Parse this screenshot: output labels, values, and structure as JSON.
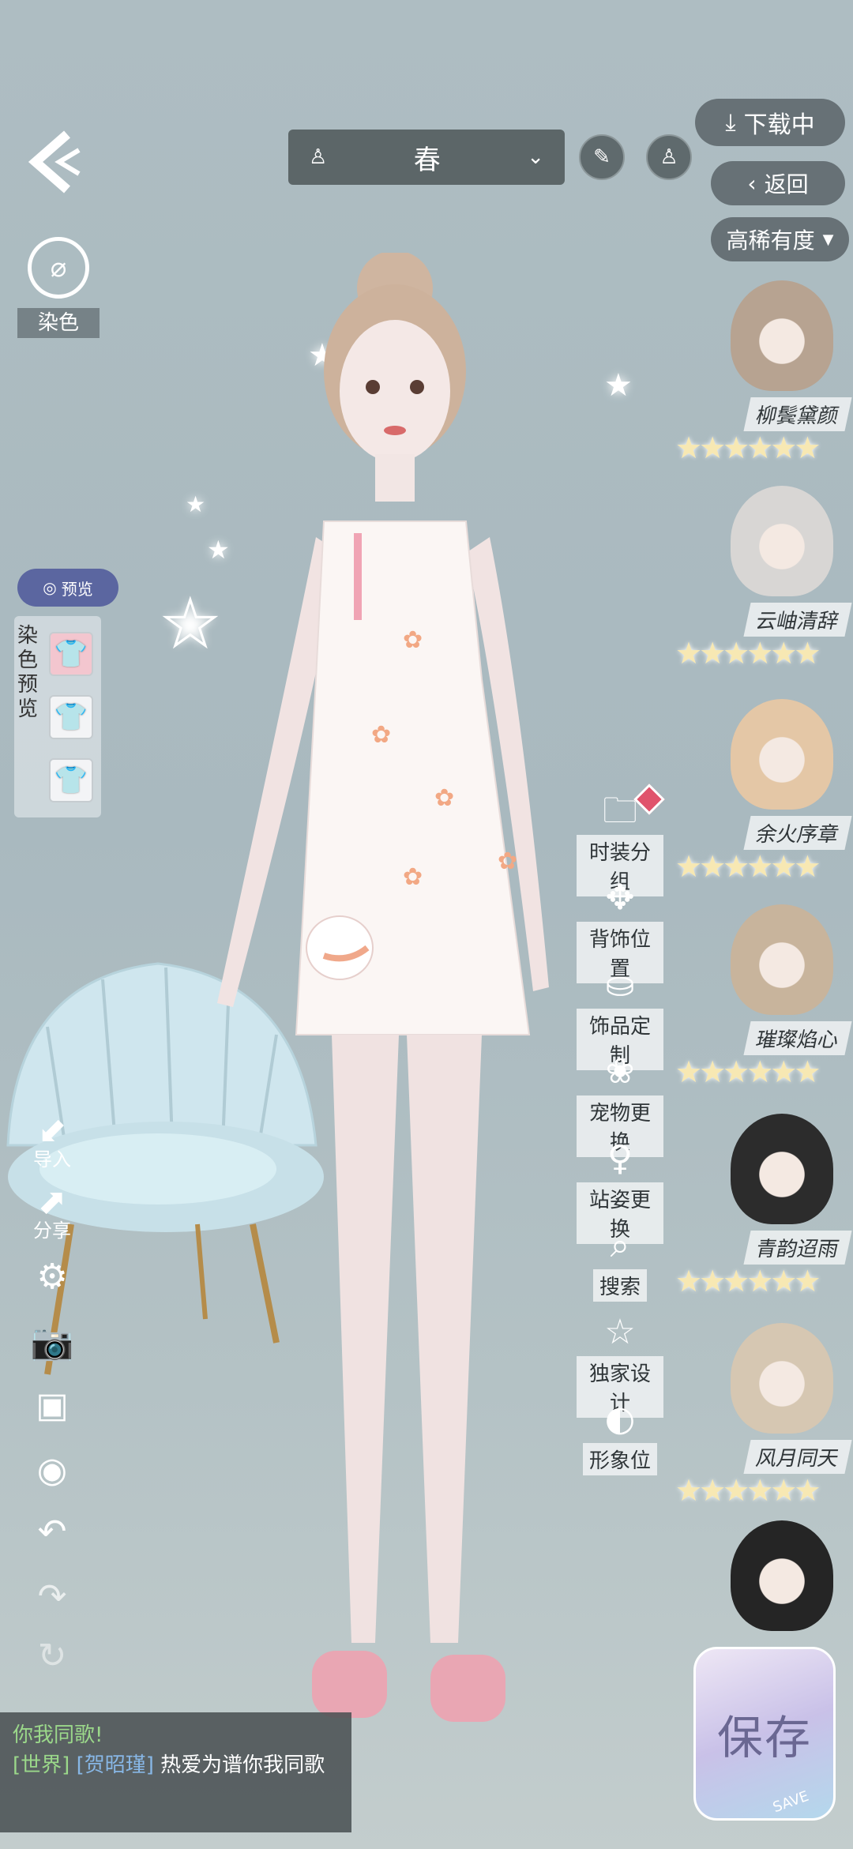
{
  "top": {
    "season": "春",
    "download_label": "下载中",
    "back_label": "返回",
    "rarity_label": "高稀有度"
  },
  "left": {
    "dye_label": "染色",
    "preview_label": "预览",
    "dye_preview_label": "染色预览",
    "import_label": "导入",
    "share_label": "分享"
  },
  "menu": [
    {
      "label": "时装分组",
      "icon": "folder-icon"
    },
    {
      "label": "背饰位置",
      "icon": "wings-icon"
    },
    {
      "label": "饰品定制",
      "icon": "bag-icon"
    },
    {
      "label": "宠物更换",
      "icon": "paw-icon"
    },
    {
      "label": "站姿更换",
      "icon": "figure-icon"
    },
    {
      "label": "搜索",
      "icon": "search-icon"
    },
    {
      "label": "独家设计",
      "icon": "star-icon"
    },
    {
      "label": "形象位",
      "icon": "portrait-icon"
    }
  ],
  "hairs": [
    {
      "name": "柳鬓黛颜",
      "stars": 6
    },
    {
      "name": "云岫清辞",
      "stars": 6
    },
    {
      "name": "余火序章",
      "stars": 6
    },
    {
      "name": "璀璨焰心",
      "stars": 6
    },
    {
      "name": "青韵迢雨",
      "stars": 6
    },
    {
      "name": "风月同天",
      "stars": 6
    }
  ],
  "chat": {
    "line1": "你我同歌!",
    "channel": "[世界]",
    "user": "[贺昭瑾]",
    "message": "热爱为谱你我同歌"
  },
  "save": {
    "label": "保存",
    "sub": "SAVE"
  }
}
